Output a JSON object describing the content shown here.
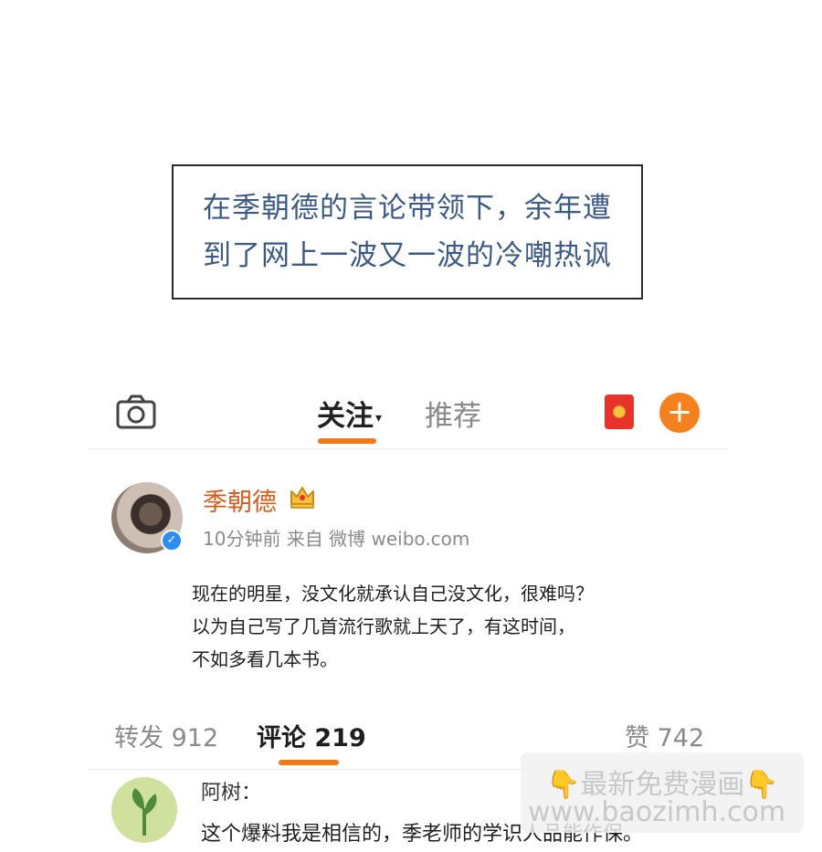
{
  "caption": {
    "line1": "在季朝德的言论带领下，余年遭",
    "line2": "到了网上一波又一波的冷嘲热讽"
  },
  "topbar": {
    "camera_icon": "camera-icon",
    "tab_follow": "关注",
    "tab_follow_caret": "▾",
    "tab_recommend": "推荐",
    "redpacket_icon": "red-packet-icon",
    "add_label": "+"
  },
  "post": {
    "username": "季朝德",
    "verified_mark": "✓",
    "meta": "10分钟前   来自 微博 weibo.com",
    "lines": [
      "现在的明星，没文化就承认自己没文化，很难吗？",
      "以为自己写了几首流行歌就上天了，有这时间，",
      "不如多看几本书。"
    ]
  },
  "stats": {
    "repost": "转发 912",
    "comment": "评论 219",
    "like": "赞 742"
  },
  "comment": {
    "name": "阿树：",
    "text": "这个爆料我是相信的，季老师的学识人品能作保。"
  },
  "watermark": {
    "line1": "👇最新免费漫画👇",
    "line2": "www.baozimh.com"
  },
  "colors": {
    "accent": "#f07a1a",
    "username": "#d35b1a",
    "caption": "#3c5a86",
    "verified": "#2c8df2"
  }
}
